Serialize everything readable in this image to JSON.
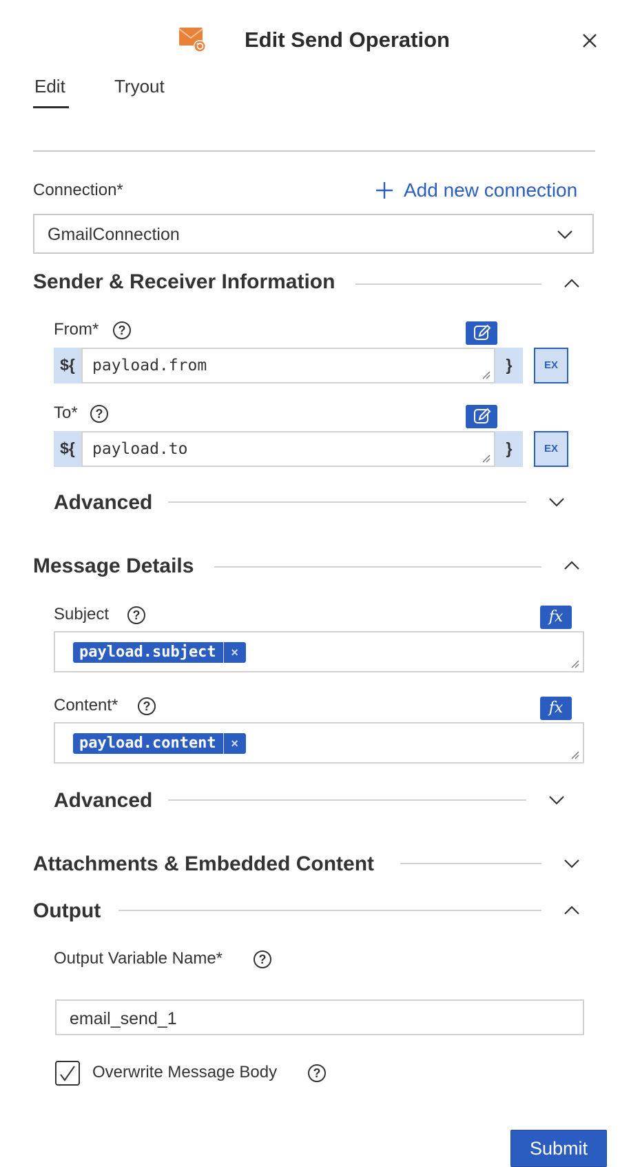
{
  "header": {
    "title": "Edit Send Operation",
    "icon": "email-icon",
    "close_icon": "close-icon"
  },
  "tabs": [
    {
      "label": "Edit",
      "active": true
    },
    {
      "label": "Tryout",
      "active": false
    }
  ],
  "connection": {
    "label": "Connection*",
    "add_link": "Add new connection",
    "selected": "GmailConnection"
  },
  "sections": {
    "sender": {
      "title": "Sender & Receiver Information",
      "from": {
        "label": "From*",
        "prefix": "${",
        "value": "payload.from",
        "suffix": "}",
        "ex": "EX"
      },
      "to": {
        "label": "To*",
        "prefix": "${",
        "value": "payload.to",
        "suffix": "}",
        "ex": "EX"
      },
      "advanced": "Advanced"
    },
    "message": {
      "title": "Message Details",
      "subject": {
        "label": "Subject",
        "fx": "fx",
        "chip": "payload.subject",
        "chip_x": "×"
      },
      "content": {
        "label": "Content*",
        "fx": "fx",
        "chip": "payload.content",
        "chip_x": "×"
      },
      "advanced": "Advanced"
    },
    "attachments": {
      "title": "Attachments & Embedded Content"
    },
    "output": {
      "title": "Output",
      "var_label": "Output Variable Name*",
      "var_value": "email_send_1",
      "overwrite_label": "Overwrite Message Body",
      "overwrite_checked": true
    }
  },
  "help_glyph": "?",
  "submit": "Submit",
  "colors": {
    "accent": "#2a5dbf",
    "light_accent": "#cfdef3",
    "icon_orange": "#e8823a"
  }
}
